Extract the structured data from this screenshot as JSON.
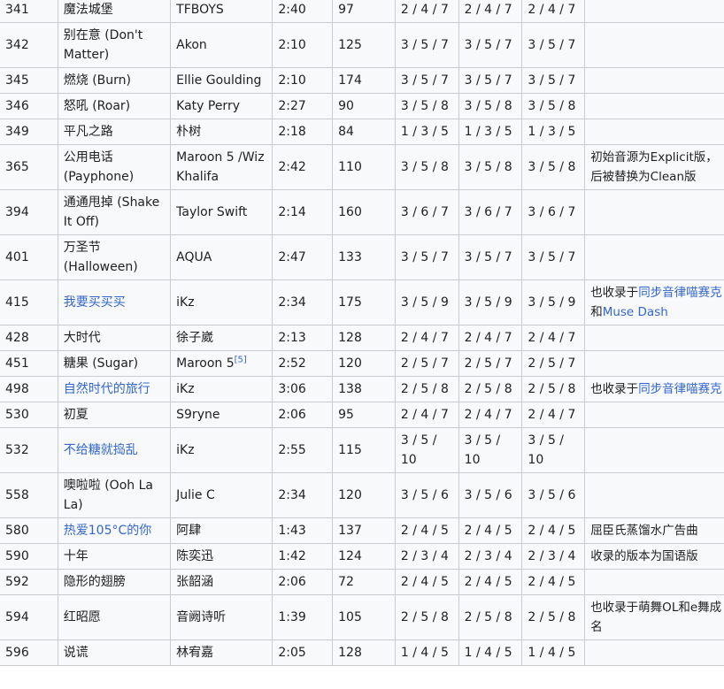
{
  "table": {
    "rows": [
      {
        "id": "341",
        "title": "魔法城堡",
        "artist": "TFBOYS",
        "time": "2:40",
        "bpm": "97",
        "d1": "2 / 4 / 7",
        "d2": "2 / 4 / 7",
        "d3": "2 / 4 / 7",
        "note": ""
      },
      {
        "id": "342",
        "title": "别在意 (Don't Matter)",
        "artist": "Akon",
        "time": "2:10",
        "bpm": "125",
        "d1": "3 / 5 / 7",
        "d2": "3 / 5 / 7",
        "d3": "3 / 5 / 7",
        "note": ""
      },
      {
        "id": "345",
        "title": "燃烧 (Burn)",
        "artist": "Ellie Goulding",
        "time": "2:10",
        "bpm": "174",
        "d1": "3 / 5 / 7",
        "d2": "3 / 5 / 7",
        "d3": "3 / 5 / 7",
        "note": ""
      },
      {
        "id": "346",
        "title": "怒吼 (Roar)",
        "artist": "Katy Perry",
        "time": "2:27",
        "bpm": "90",
        "d1": "3 / 5 / 8",
        "d2": "3 / 5 / 8",
        "d3": "3 / 5 / 8",
        "note": ""
      },
      {
        "id": "349",
        "title": "平凡之路",
        "artist": "朴树",
        "time": "2:18",
        "bpm": "84",
        "d1": "1 / 3 / 5",
        "d2": "1 / 3 / 5",
        "d3": "1 / 3 / 5",
        "note": ""
      },
      {
        "id": "365",
        "title": "公用电话 (Payphone)",
        "artist": "Maroon 5 /Wiz Khalifa",
        "time": "2:42",
        "bpm": "110",
        "d1": "3 / 5 / 8",
        "d2": "3 / 5 / 8",
        "d3": "3 / 5 / 8",
        "note": "初始音源为Explicit版，后被替换为Clean版"
      },
      {
        "id": "394",
        "title": "通通甩掉 (Shake It Off)",
        "artist": "Taylor Swift",
        "time": "2:14",
        "bpm": "160",
        "d1": "3 / 6 / 7",
        "d2": "3 / 6 / 7",
        "d3": "3 / 6 / 7",
        "note": ""
      },
      {
        "id": "401",
        "title": "万圣节 (Halloween)",
        "artist": "AQUA",
        "time": "2:47",
        "bpm": "133",
        "d1": "3 / 5 / 7",
        "d2": "3 / 5 / 7",
        "d3": "3 / 5 / 7",
        "note": ""
      },
      {
        "id": "415",
        "title": "我要买买买",
        "title_link": true,
        "artist": "iKz",
        "time": "2:34",
        "bpm": "175",
        "d1": "3 / 5 / 9",
        "d2": "3 / 5 / 9",
        "d3": "3 / 5 / 9",
        "note_parts": [
          {
            "t": "也收录于"
          },
          {
            "t": "同步音律喵赛克",
            "link": true
          },
          {
            "t": "和"
          },
          {
            "t": "Muse Dash",
            "link": true
          }
        ]
      },
      {
        "id": "428",
        "title": "大时代",
        "artist": "徐子崴",
        "time": "2:13",
        "bpm": "128",
        "d1": "2 / 4 / 7",
        "d2": "2 / 4 / 7",
        "d3": "2 / 4 / 7",
        "note": ""
      },
      {
        "id": "451",
        "title": "糖果 (Sugar)",
        "artist": "Maroon 5",
        "artist_sup": "[5]",
        "time": "2:52",
        "bpm": "120",
        "d1": "2 / 5 / 7",
        "d2": "2 / 5 / 7",
        "d3": "2 / 5 / 7",
        "note": ""
      },
      {
        "id": "498",
        "title": "自然时代的旅行",
        "title_link": true,
        "artist": "iKz",
        "time": "3:06",
        "bpm": "138",
        "d1": "2 / 5 / 8",
        "d2": "2 / 5 / 8",
        "d3": "2 / 5 / 8",
        "note_parts": [
          {
            "t": "也收录于"
          },
          {
            "t": "同步音律喵赛克",
            "link": true
          }
        ]
      },
      {
        "id": "530",
        "title": "初夏",
        "artist": "S9ryne",
        "time": "2:06",
        "bpm": "95",
        "d1": "2 / 4 / 7",
        "d2": "2 / 4 / 7",
        "d3": "2 / 4 / 7",
        "note": ""
      },
      {
        "id": "532",
        "title": "不给糖就捣乱",
        "title_link": true,
        "artist": "iKz",
        "time": "2:55",
        "bpm": "115",
        "d1": "3 / 5 / 10",
        "d2": "3 / 5 / 10",
        "d3": "3 / 5 / 10",
        "note": ""
      },
      {
        "id": "558",
        "title": "噢啦啦 (Ooh La La)",
        "artist": "Julie C",
        "time": "2:34",
        "bpm": "120",
        "d1": "3 / 5 / 6",
        "d2": "3 / 5 / 6",
        "d3": "3 / 5 / 6",
        "note": ""
      },
      {
        "id": "580",
        "title": "热爱105°C的你",
        "title_link": true,
        "artist": "阿肆",
        "time": "1:43",
        "bpm": "137",
        "d1": "2 / 4 / 5",
        "d2": "2 / 4 / 5",
        "d3": "2 / 4 / 5",
        "note": "屈臣氏蒸馏水广告曲"
      },
      {
        "id": "590",
        "title": "十年",
        "artist": "陈奕迅",
        "time": "1:42",
        "bpm": "124",
        "d1": "2 / 3 / 4",
        "d2": "2 / 3 / 4",
        "d3": "2 / 3 / 4",
        "note": "收录的版本为国语版"
      },
      {
        "id": "592",
        "title": "隐形的翅膀",
        "artist": "张韶涵",
        "time": "2:06",
        "bpm": "72",
        "d1": "2 / 4 / 5",
        "d2": "2 / 4 / 5",
        "d3": "2 / 4 / 5",
        "note": ""
      },
      {
        "id": "594",
        "title": "红昭愿",
        "artist": "音阙诗听",
        "time": "1:39",
        "bpm": "105",
        "d1": "2 / 5 / 8",
        "d2": "2 / 5 / 8",
        "d3": "2 / 5 / 8",
        "note": "也收录于萌舞OL和e舞成名"
      },
      {
        "id": "596",
        "title": "说谎",
        "artist": "林宥嘉",
        "time": "2:05",
        "bpm": "128",
        "d1": "1 / 4 / 5",
        "d2": "1 / 4 / 5",
        "d3": "1 / 4 / 5",
        "note": ""
      }
    ]
  }
}
